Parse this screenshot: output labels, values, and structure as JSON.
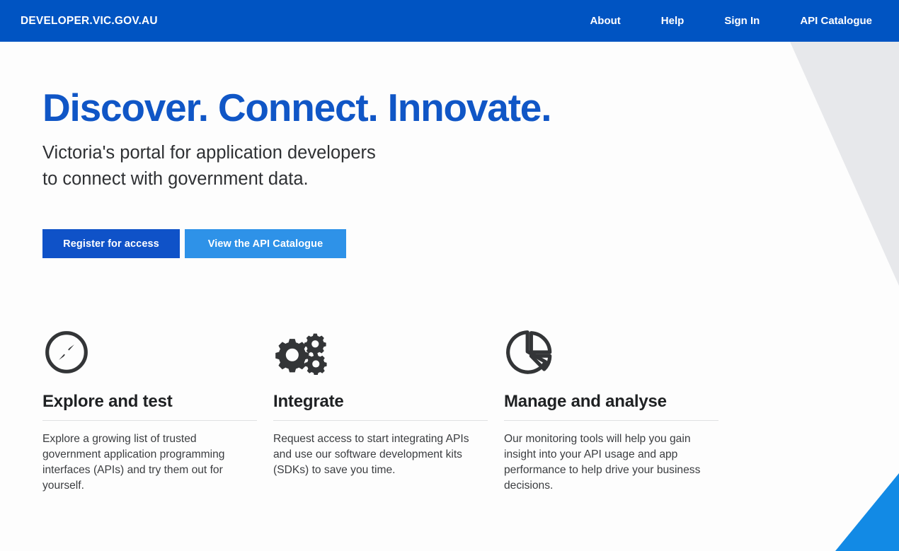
{
  "header": {
    "brand": "DEVELOPER.VIC.GOV.AU",
    "nav": [
      {
        "label": "About"
      },
      {
        "label": "Help"
      },
      {
        "label": "Sign In"
      },
      {
        "label": "API Catalogue"
      }
    ],
    "background_color": "#0054c2",
    "text_color": "#ffffff"
  },
  "hero": {
    "title": "Discover. Connect. Innovate.",
    "title_color": "#1056c6",
    "subtitle": "Victoria's portal for application developers\nto connect with government data.",
    "buttons": [
      {
        "label": "Register for access",
        "color": "#0f52c8"
      },
      {
        "label": "View the API Catalogue",
        "color": "#2e92e8"
      }
    ]
  },
  "features": [
    {
      "icon": "compass-icon",
      "title": "Explore and test",
      "body": "Explore a growing list of trusted government application programming interfaces (APIs) and try them out for yourself."
    },
    {
      "icon": "gears-icon",
      "title": "Integrate",
      "body": "Request access to start integrating APIs and use our software development kits (SDKs) to save you time."
    },
    {
      "icon": "pie-chart-icon",
      "title": "Manage and analyse",
      "body": "Our monitoring tools will help you gain insight into your API usage and app performance to help drive your business decisions."
    }
  ],
  "decorations": {
    "top_right_triangle_color": "#e7e8eb",
    "bottom_right_triangle_color": "#128ae5",
    "page_background": "#fdfdfd"
  }
}
